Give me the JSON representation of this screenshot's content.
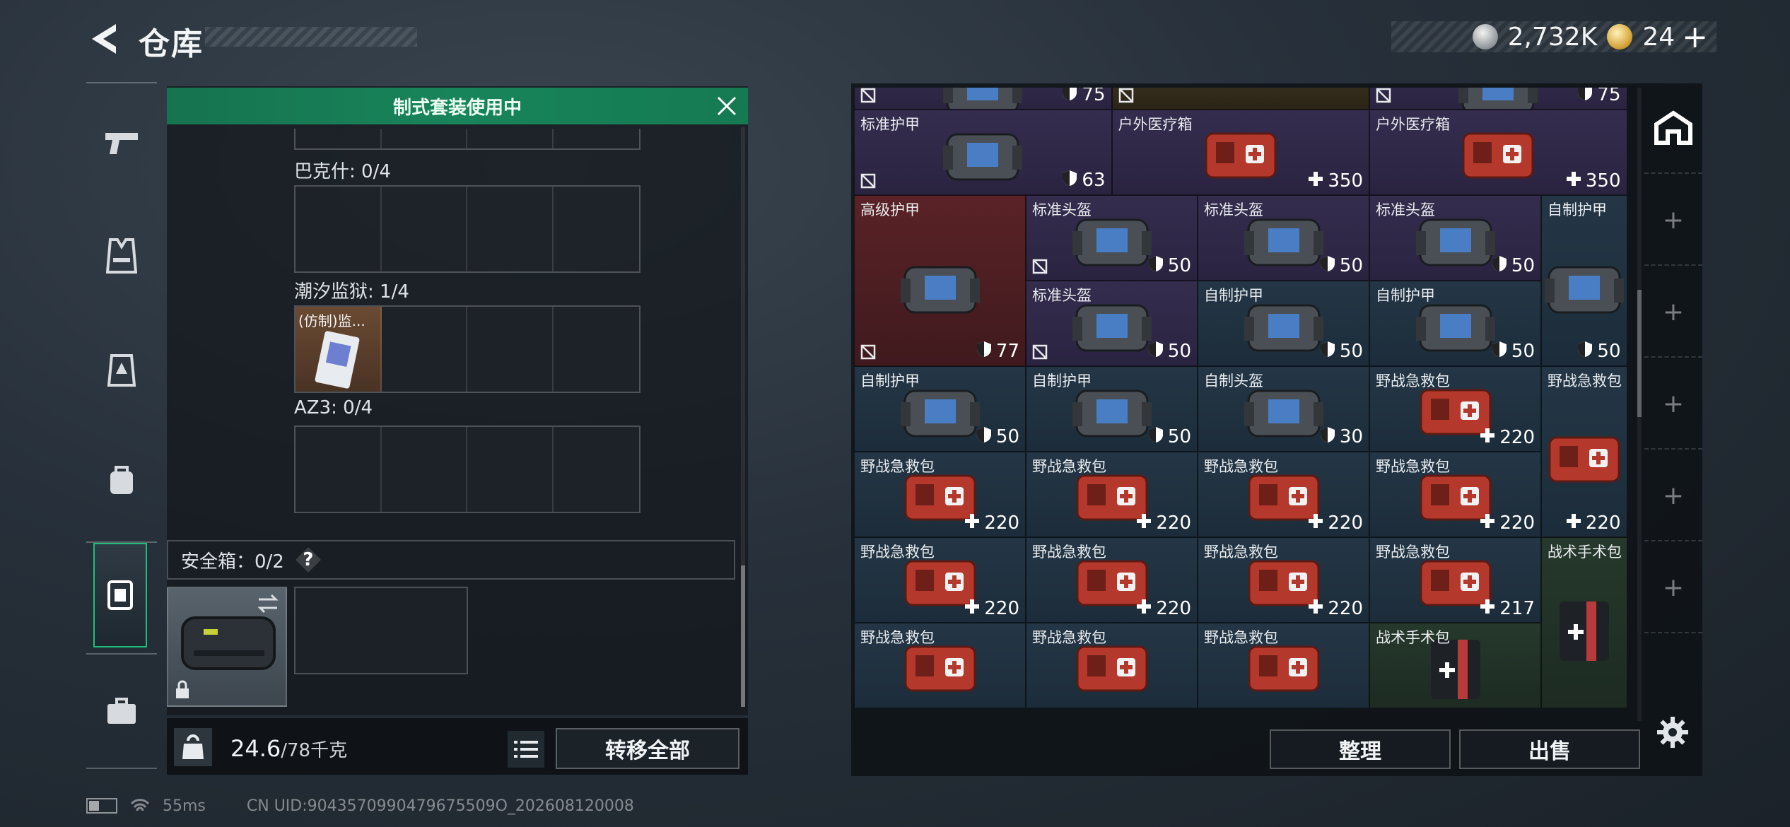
{
  "header": {
    "title": "仓库",
    "silver_amount": "2,732K",
    "gold_amount": "24",
    "add_label": "+"
  },
  "left_nav": {
    "items": [
      {
        "name": "weapon-tab",
        "icon": "pistol-icon"
      },
      {
        "name": "armor-tab",
        "icon": "vest-icon"
      },
      {
        "name": "rig-tab",
        "icon": "chest-rig-icon"
      },
      {
        "name": "backpack-tab",
        "icon": "backpack-icon"
      },
      {
        "name": "safebox-tab",
        "icon": "safebox-icon",
        "active": true
      },
      {
        "name": "toolbox-tab",
        "icon": "briefcase-icon"
      }
    ]
  },
  "loadout": {
    "banner": "制式套装使用中",
    "sections": [
      {
        "label": "巴克什: 0/4"
      },
      {
        "label": "潮汐监狱: 1/4",
        "item": "(仿制)监..."
      },
      {
        "label": "AZ3: 0/4"
      }
    ],
    "safebox_label": "安全箱：0/2",
    "help_label": "?",
    "weight_current": "24.6",
    "weight_max": "/78千克",
    "weight_icon_label": "KG",
    "transfer_all": "转移全部"
  },
  "status": {
    "ping": "55ms",
    "uid": "CN UID:9043570990479675509O_202608120008"
  },
  "stash": {
    "items": [
      {
        "name": "",
        "value": "75",
        "kind": "shield",
        "color": "purple",
        "col": 0,
        "row": 0,
        "w": 1.5,
        "h": 0.5,
        "marked": true
      },
      {
        "name": "",
        "value": "",
        "kind": "none",
        "color": "gold",
        "col": 1.5,
        "row": 0,
        "w": 1.5,
        "h": 0.5,
        "marked": true
      },
      {
        "name": "",
        "value": "75",
        "kind": "shield",
        "color": "purple",
        "col": 3,
        "row": 0,
        "w": 1.5,
        "h": 0.5,
        "marked": true
      },
      {
        "name": "标准护甲",
        "value": "63",
        "kind": "shield",
        "color": "purple",
        "col": 0,
        "row": 0.5,
        "w": 1.5,
        "h": 1,
        "marked": true
      },
      {
        "name": "户外医疗箱",
        "value": "350",
        "kind": "heal",
        "color": "purple",
        "col": 1.5,
        "row": 0.5,
        "w": 1.5,
        "h": 1
      },
      {
        "name": "户外医疗箱",
        "value": "350",
        "kind": "heal",
        "color": "purple",
        "col": 3,
        "row": 0.5,
        "w": 1.5,
        "h": 1
      },
      {
        "name": "高级护甲",
        "value": "77",
        "kind": "shield",
        "color": "red",
        "col": 0,
        "row": 1.5,
        "w": 1,
        "h": 2,
        "marked": true
      },
      {
        "name": "标准头盔",
        "value": "50",
        "kind": "shield",
        "color": "purple",
        "col": 1,
        "row": 1.5,
        "w": 1,
        "h": 1,
        "marked": true
      },
      {
        "name": "标准头盔",
        "value": "50",
        "kind": "shield",
        "color": "purple",
        "col": 2,
        "row": 1.5,
        "w": 1,
        "h": 1
      },
      {
        "name": "标准头盔",
        "value": "50",
        "kind": "shield",
        "color": "purple",
        "col": 3,
        "row": 1.5,
        "w": 1,
        "h": 1
      },
      {
        "name": "自制护甲",
        "value": "50",
        "kind": "shield",
        "color": "blue",
        "col": 4,
        "row": 1.5,
        "w": 0.5,
        "h": 2
      },
      {
        "name": "标准头盔",
        "value": "50",
        "kind": "shield",
        "color": "purple",
        "col": 1,
        "row": 2.5,
        "w": 1,
        "h": 1,
        "marked": true
      },
      {
        "name": "自制护甲",
        "value": "50",
        "kind": "shield",
        "color": "blue",
        "col": 2,
        "row": 2.5,
        "w": 1,
        "h": 1
      },
      {
        "name": "自制护甲",
        "value": "50",
        "kind": "shield",
        "color": "blue",
        "col": 3,
        "row": 2.5,
        "w": 1,
        "h": 1
      },
      {
        "name": "自制护甲",
        "value": "50",
        "kind": "shield",
        "color": "blue",
        "col": 0,
        "row": 3.5,
        "w": 1,
        "h": 1
      },
      {
        "name": "自制护甲",
        "value": "50",
        "kind": "shield",
        "color": "blue",
        "col": 1,
        "row": 3.5,
        "w": 1,
        "h": 1
      },
      {
        "name": "自制头盔",
        "value": "30",
        "kind": "shield",
        "color": "blue",
        "col": 2,
        "row": 3.5,
        "w": 1,
        "h": 1
      },
      {
        "name": "野战急救包",
        "value": "220",
        "kind": "heal",
        "color": "blue",
        "col": 3,
        "row": 3.5,
        "w": 1,
        "h": 1
      },
      {
        "name": "野战急救包",
        "value": "220",
        "kind": "heal",
        "color": "blue",
        "col": 4,
        "row": 3.5,
        "w": 0.5,
        "h": 2
      },
      {
        "name": "野战急救包",
        "value": "220",
        "kind": "heal",
        "color": "blue",
        "col": 0,
        "row": 4.5,
        "w": 1,
        "h": 1
      },
      {
        "name": "野战急救包",
        "value": "220",
        "kind": "heal",
        "color": "blue",
        "col": 1,
        "row": 4.5,
        "w": 1,
        "h": 1
      },
      {
        "name": "野战急救包",
        "value": "220",
        "kind": "heal",
        "color": "blue",
        "col": 2,
        "row": 4.5,
        "w": 1,
        "h": 1
      },
      {
        "name": "野战急救包",
        "value": "220",
        "kind": "heal",
        "color": "blue",
        "col": 3,
        "row": 4.5,
        "w": 1,
        "h": 1
      },
      {
        "name": "野战急救包",
        "value": "220",
        "kind": "heal",
        "color": "blue",
        "col": 0,
        "row": 5.5,
        "w": 1,
        "h": 1
      },
      {
        "name": "野战急救包",
        "value": "220",
        "kind": "heal",
        "color": "blue",
        "col": 1,
        "row": 5.5,
        "w": 1,
        "h": 1
      },
      {
        "name": "野战急救包",
        "value": "220",
        "kind": "heal",
        "color": "blue",
        "col": 2,
        "row": 5.5,
        "w": 1,
        "h": 1
      },
      {
        "name": "野战急救包",
        "value": "217",
        "kind": "heal",
        "color": "blue",
        "col": 3,
        "row": 5.5,
        "w": 1,
        "h": 1
      },
      {
        "name": "战术手术包",
        "value": "",
        "kind": "none",
        "color": "green",
        "col": 4,
        "row": 5.5,
        "w": 0.5,
        "h": 2
      },
      {
        "name": "野战急救包",
        "value": "",
        "kind": "none",
        "color": "blue",
        "col": 0,
        "row": 6.5,
        "w": 1,
        "h": 1
      },
      {
        "name": "野战急救包",
        "value": "",
        "kind": "none",
        "color": "blue",
        "col": 1,
        "row": 6.5,
        "w": 1,
        "h": 1
      },
      {
        "name": "野战急救包",
        "value": "",
        "kind": "none",
        "color": "blue",
        "col": 2,
        "row": 6.5,
        "w": 1,
        "h": 1
      },
      {
        "name": "战术手术包",
        "value": "",
        "kind": "none",
        "color": "green",
        "col": 3,
        "row": 6.5,
        "w": 1,
        "h": 1
      }
    ],
    "sort_label": "整理",
    "sell_label": "出售"
  },
  "right_rail": {
    "tabs": [
      "stash-home-icon",
      "+",
      "+",
      "+",
      "+",
      "+"
    ]
  }
}
